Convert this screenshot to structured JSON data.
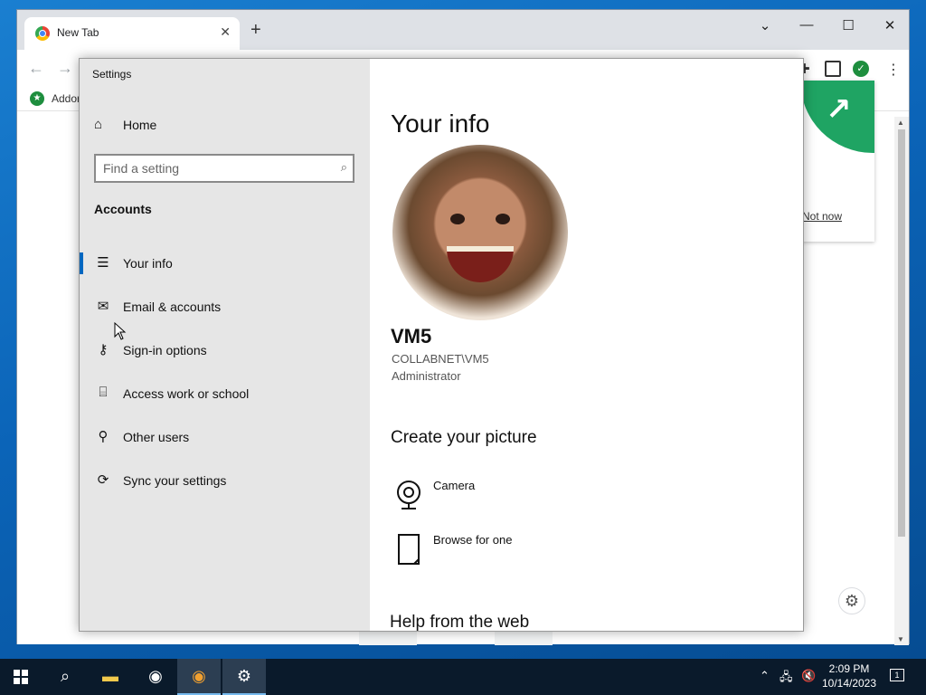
{
  "browser": {
    "tab_title": "New Tab",
    "new_tab_symbol": "+",
    "bookmark_label": "Addon",
    "popup_link": "Not now",
    "controls": {
      "minimize": "—",
      "maximize": "☐",
      "close": "✕",
      "tab_search": "⌄"
    }
  },
  "settings": {
    "window_title": "Settings",
    "home_label": "Home",
    "search_placeholder": "Find a setting",
    "section_title": "Accounts",
    "nav_items": [
      {
        "label": "Your info",
        "icon": "person-card-icon"
      },
      {
        "label": "Email & accounts",
        "icon": "mail-icon"
      },
      {
        "label": "Sign-in options",
        "icon": "key-icon"
      },
      {
        "label": "Access work or school",
        "icon": "briefcase-icon"
      },
      {
        "label": "Other users",
        "icon": "add-person-icon"
      },
      {
        "label": "Sync your settings",
        "icon": "sync-icon"
      }
    ],
    "content": {
      "heading": "Your info",
      "user_name": "VM5",
      "user_domain": "COLLABNET\\VM5",
      "user_role": "Administrator",
      "picture_heading": "Create your picture",
      "camera_label": "Camera",
      "browse_label": "Browse for one",
      "help_heading": "Help from the web"
    }
  },
  "taskbar": {
    "time": "2:09 PM",
    "date": "10/14/2023",
    "notification_count": "1"
  },
  "colors": {
    "accent": "#0067c0",
    "nav_pane": "#e6e6e6",
    "taskbar": "#0a1a2b",
    "popup_green": "#1fa463"
  }
}
